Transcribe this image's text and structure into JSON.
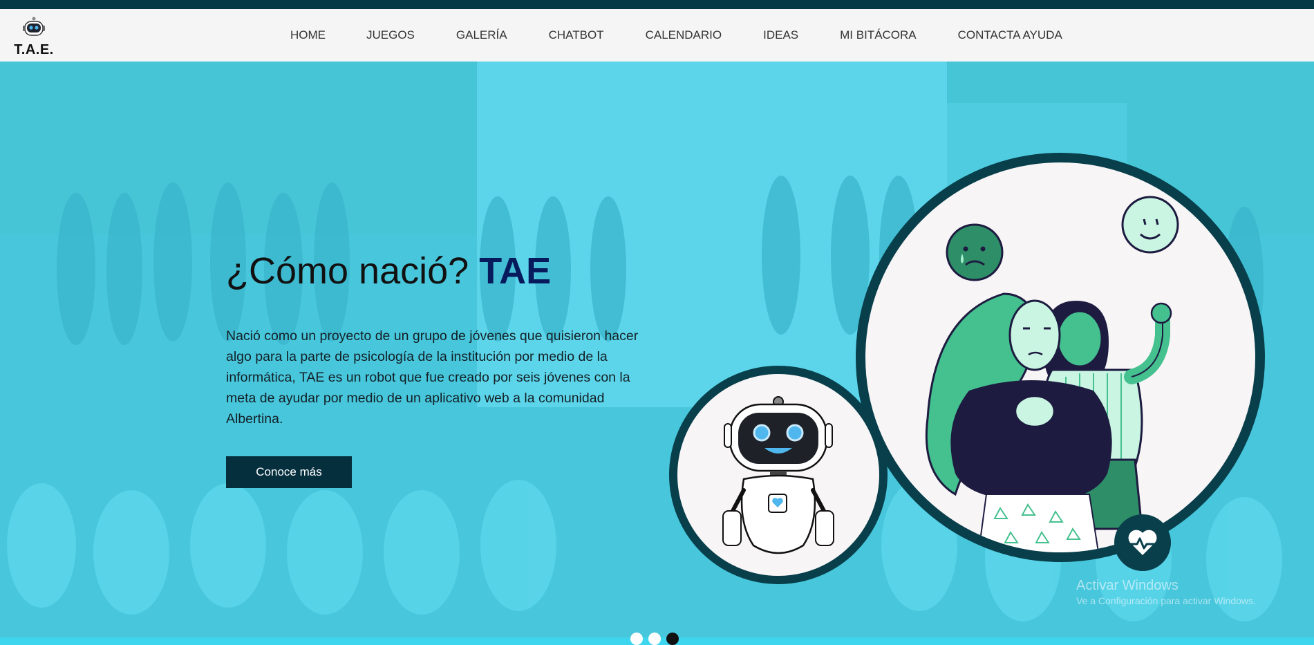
{
  "brand": {
    "logo_text": "T.A.E."
  },
  "nav": {
    "items": [
      "HOME",
      "JUEGOS",
      "GALERÍA",
      "CHATBOT",
      "CALENDARIO",
      "IDEAS",
      "MI BITÁCORA",
      "CONTACTA AYUDA"
    ]
  },
  "hero": {
    "title_prefix": "¿Cómo nació?",
    "title_brand": "TAE",
    "body": "Nació como un proyecto de un grupo de jóvenes que quisieron hacer algo para la parte de psicología de la institución por medio de la informática, TAE es un robot que fue creado por seis jóvenes con la meta de ayudar por medio de un aplicativo web a la comunidad Albertina.",
    "cta_label": "Conoce más"
  },
  "overlay_watermark": {
    "line1": "Activar Windows",
    "line2": "Ve a Configuración para activar Windows."
  },
  "carousel": {
    "slide_count": 3,
    "active_index": 2
  },
  "colors": {
    "top_strip": "#033a45",
    "hero_background": "#3ed6ef",
    "title_brand": "#071a5c",
    "cta_background": "#062f3e",
    "circle_border": "#083f4b",
    "illustration_green": "#45c08f",
    "illustration_navy": "#1d1b40"
  },
  "icons": {
    "logo": "robot-head-icon",
    "badge": "heart-pulse-icon",
    "sad_bubble": "sad-face-icon",
    "happy_bubble": "happy-face-icon"
  }
}
